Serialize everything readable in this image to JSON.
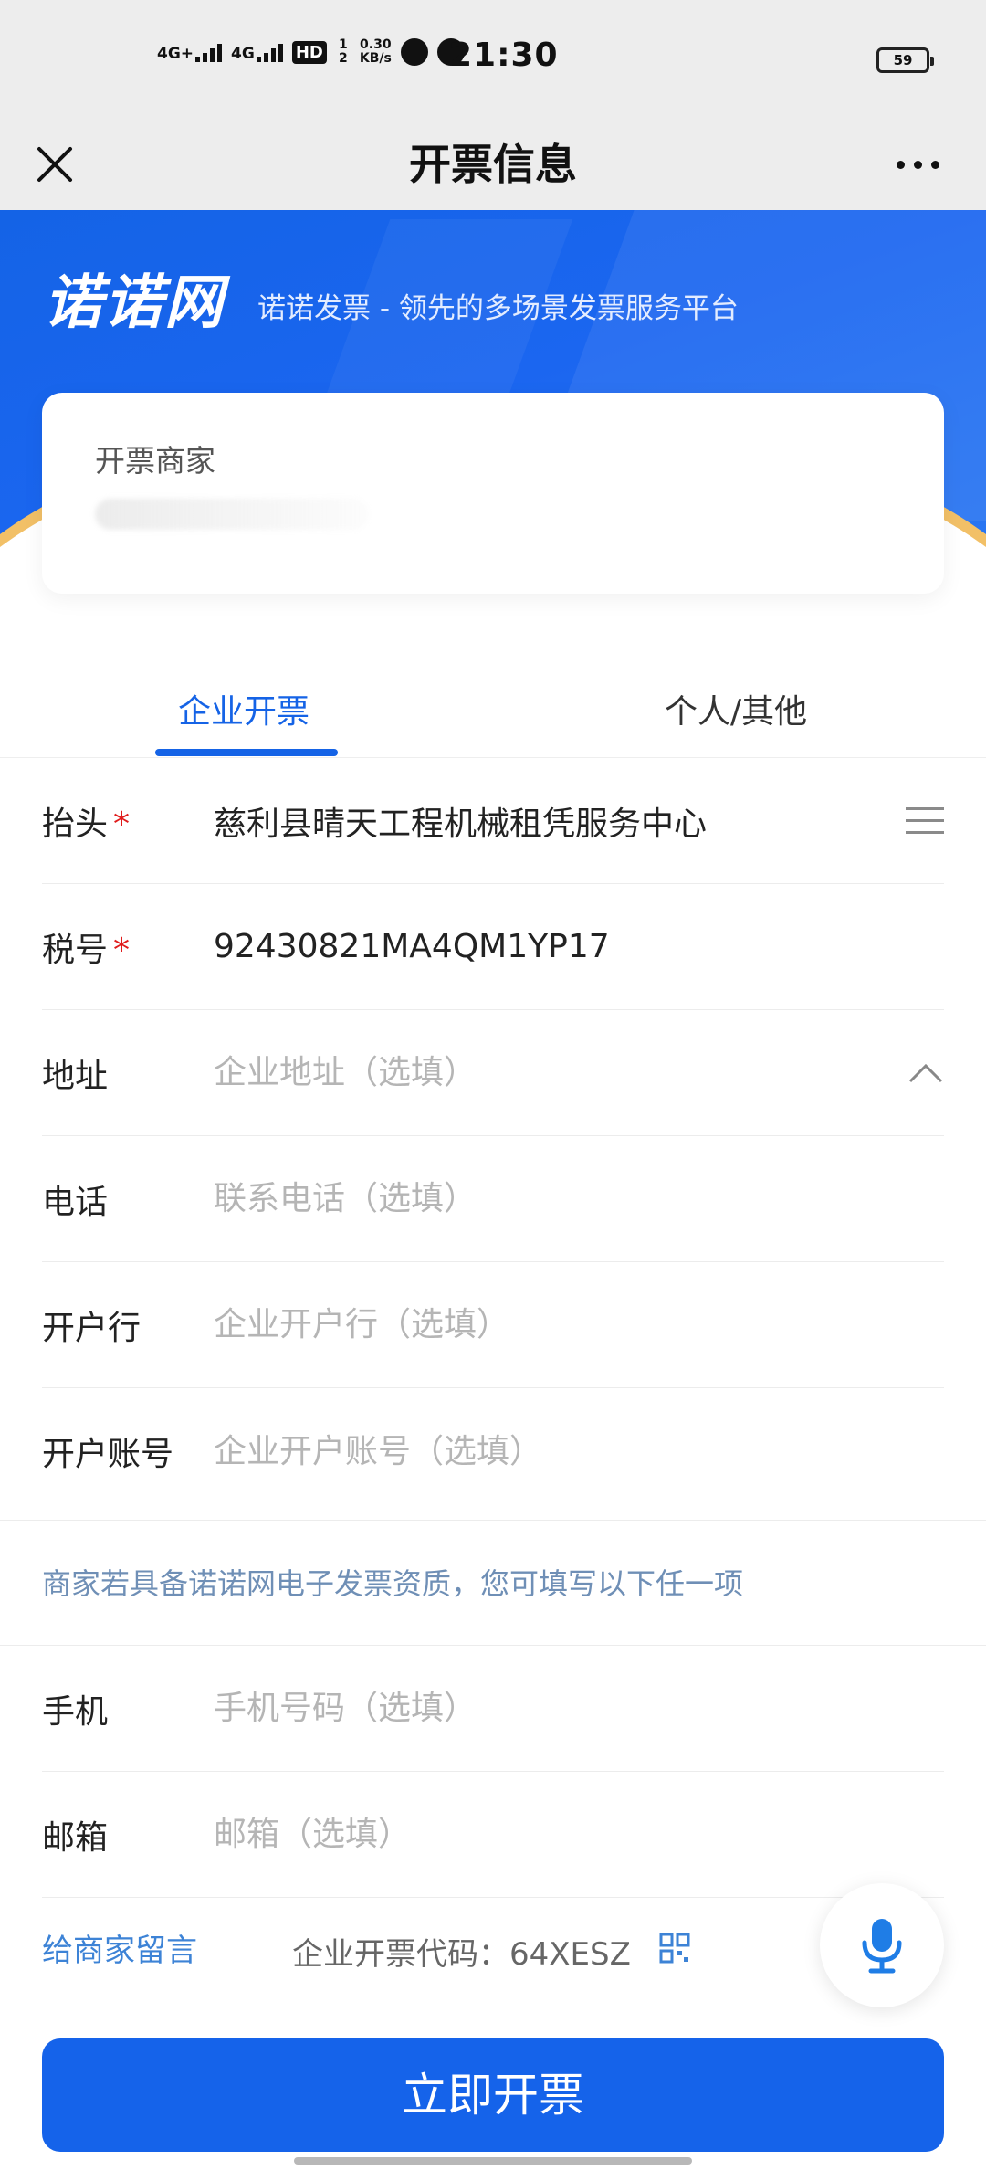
{
  "status_bar": {
    "network_1": "4G+",
    "network_2": "4G",
    "hd_label": "HD",
    "sim_numbers": "1 2",
    "net_speed": "0.30",
    "net_unit": "KB/s",
    "time": "21:30",
    "battery": "59"
  },
  "header": {
    "title": "开票信息"
  },
  "banner": {
    "logo": "诺诺网",
    "tagline": "诺诺发票 - 领先的多场景发票服务平台"
  },
  "merchant": {
    "label": "开票商家"
  },
  "tabs": [
    {
      "label": "企业开票",
      "active": true
    },
    {
      "label": "个人/其他",
      "active": false
    }
  ],
  "form": {
    "title_row": {
      "label": "抬头",
      "value": "慈利县晴天工程机械租凭服务中心",
      "required": "*"
    },
    "tax_row": {
      "label": "税号",
      "value": "92430821MA4QM1YP17",
      "required": "*"
    },
    "address_row": {
      "label": "地址",
      "placeholder": "企业地址（选填）"
    },
    "phone_row": {
      "label": "电话",
      "placeholder": "联系电话（选填）"
    },
    "bank_row": {
      "label": "开户行",
      "placeholder": "企业开户行（选填）"
    },
    "account_row": {
      "label": "开户账号",
      "placeholder": "企业开户账号（选填）"
    },
    "notice": "商家若具备诺诺网电子发票资质，您可填写以下任一项",
    "mobile_row": {
      "label": "手机",
      "placeholder": "手机号码（选填）"
    },
    "email_row": {
      "label": "邮箱",
      "placeholder": "邮箱（选填）"
    }
  },
  "footer": {
    "leave_message": "给商家留言",
    "invoice_code": "企业开票代码：64XESZ",
    "submit": "立即开票"
  },
  "colors": {
    "brand_blue": "#1563e6",
    "required_red": "#e01c1c",
    "link_blue": "#3d83d6",
    "banner_accent": "#f2c067"
  },
  "icons": [
    "close-icon",
    "more-icon",
    "menu-list-icon",
    "chevron-up-icon",
    "qr-code-icon",
    "microphone-icon"
  ]
}
